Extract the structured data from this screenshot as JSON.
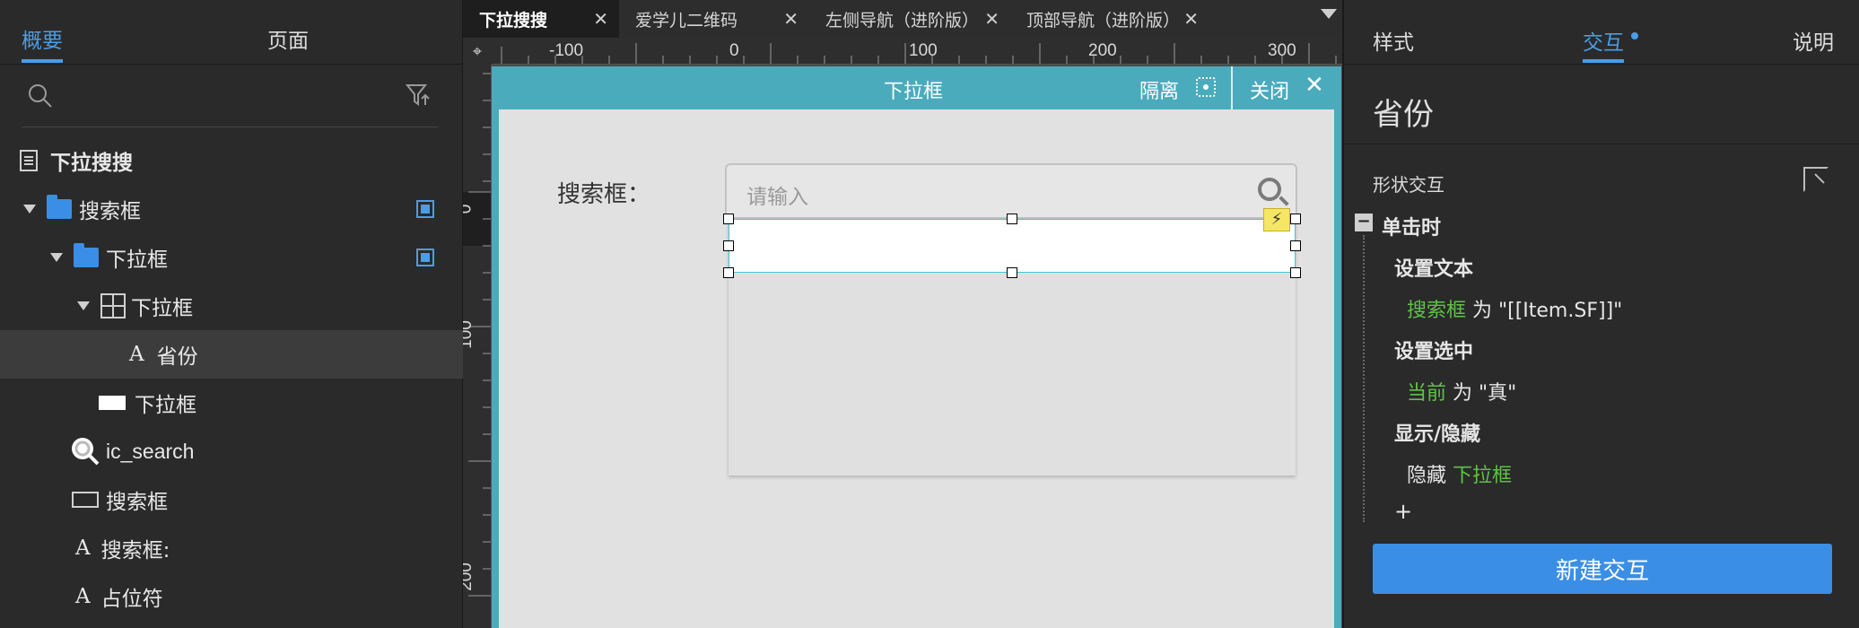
{
  "left_panel": {
    "tabs": [
      "概要",
      "页面"
    ],
    "tree": [
      {
        "label": "下拉搜搜",
        "icon": "page-icon"
      },
      {
        "label": "搜索框",
        "icon": "folder-icon"
      },
      {
        "label": "下拉框",
        "icon": "folder-icon"
      },
      {
        "label": "下拉框",
        "icon": "repeater-icon"
      },
      {
        "label": "省份",
        "icon": "text-icon"
      },
      {
        "label": "下拉框",
        "icon": "rectangle-icon"
      },
      {
        "label": "ic_search",
        "icon": "image-icon"
      },
      {
        "label": "搜索框",
        "icon": "textfield-icon"
      },
      {
        "label": "搜索框:",
        "icon": "text-icon"
      },
      {
        "label": "占位符",
        "icon": "text-icon"
      }
    ]
  },
  "doc_tabs": [
    "下拉搜搜",
    "爱学儿二维码",
    "左侧导航（进阶版）",
    "顶部导航（进阶版）"
  ],
  "ruler": {
    "h_labels": [
      "-100",
      "0",
      "100",
      "200",
      "300"
    ],
    "v_labels": [
      "0",
      "100",
      "200"
    ]
  },
  "canvas": {
    "frame_title": "下拉框",
    "isolate_label": "隔离",
    "close_label": "关闭",
    "search_label": "搜索框：",
    "search_placeholder": "请输入"
  },
  "right_panel": {
    "tabs": [
      "样式",
      "交互",
      "说明"
    ],
    "shape_name": "省份",
    "section_title": "形状交互",
    "event": "单击时",
    "actions": [
      {
        "title": "设置文本",
        "target": "搜索框",
        "detail": " 为 \"[[Item.SF]]\""
      },
      {
        "title": "设置选中",
        "target": "当前",
        "detail": " 为 \"真\""
      },
      {
        "title": "显示/隐藏",
        "prefix": "隐藏 ",
        "target": "下拉框"
      }
    ],
    "add_symbol": "+",
    "new_button": "新建交互"
  },
  "colors": {
    "accent": "#4a9de6",
    "frame": "#4aabbd",
    "green": "#5fc346",
    "button": "#3a8ee6"
  }
}
